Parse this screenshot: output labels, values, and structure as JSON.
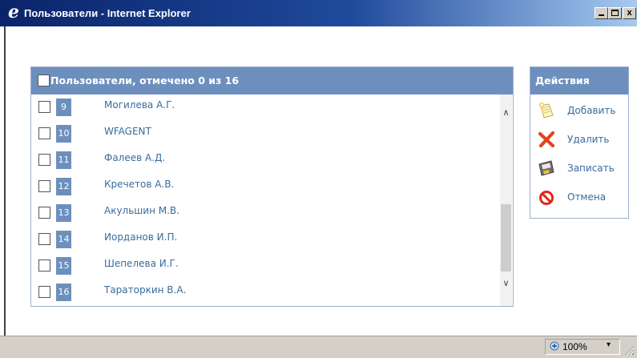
{
  "window": {
    "title": "Пользователи - Internet Explorer",
    "title_icon": "e",
    "buttons": {
      "minimize": "_",
      "maximize": "□",
      "close": "x"
    }
  },
  "users_panel": {
    "title": "Пользователи, отмечено 0 из 16",
    "rows": [
      {
        "num": "9",
        "name": "Могилева А.Г."
      },
      {
        "num": "10",
        "name": "WFAGENT"
      },
      {
        "num": "11",
        "name": "Фалеев А.Д."
      },
      {
        "num": "12",
        "name": "Кречетов А.В."
      },
      {
        "num": "13",
        "name": "Акульшин М.В."
      },
      {
        "num": "14",
        "name": "Иорданов И.П."
      },
      {
        "num": "15",
        "name": "Шепелева И.Г."
      },
      {
        "num": "16",
        "name": "Тараторкин В.А."
      }
    ],
    "scroll_up": "∧",
    "scroll_down": "∨"
  },
  "actions_panel": {
    "title": "Действия",
    "items": [
      {
        "label": "Добавить",
        "icon": "add-note-icon"
      },
      {
        "label": "Удалить",
        "icon": "delete-x-icon"
      },
      {
        "label": "Записать",
        "icon": "save-disk-icon"
      },
      {
        "label": "Отмена",
        "icon": "cancel-circle-icon"
      }
    ]
  },
  "statusbar": {
    "zoom": "100%",
    "zoom_arrow": "▾"
  },
  "colors": {
    "header": "#6d8fbd",
    "link": "#3a6b9c",
    "titlebar_start": "#0a246a",
    "titlebar_end": "#a6caf0"
  }
}
